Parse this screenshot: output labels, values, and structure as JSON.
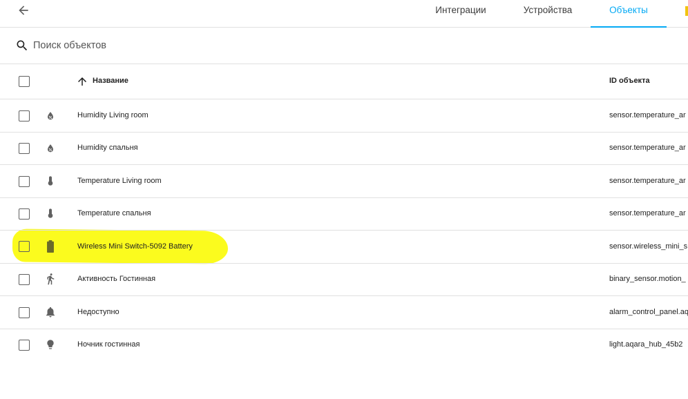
{
  "header": {
    "tabs": [
      {
        "label": "Интеграции",
        "active": false
      },
      {
        "label": "Устройства",
        "active": false
      },
      {
        "label": "Объекты",
        "active": true
      }
    ],
    "accent_color": "#03a9f4"
  },
  "search": {
    "placeholder": "Поиск объектов",
    "value": ""
  },
  "table": {
    "columns": {
      "name": "Название",
      "entity_id": "ID объекта"
    },
    "sort": {
      "column": "name",
      "direction": "ascending"
    },
    "rows": [
      {
        "icon": "water-percent-icon",
        "name": "Humidity Living room",
        "entity_id": "sensor.temperature_ar",
        "highlighted": false
      },
      {
        "icon": "water-percent-icon",
        "name": "Humidity спальня",
        "entity_id": "sensor.temperature_ar",
        "highlighted": false
      },
      {
        "icon": "thermometer-icon",
        "name": "Temperature Living room",
        "entity_id": "sensor.temperature_ar",
        "highlighted": false
      },
      {
        "icon": "thermometer-icon",
        "name": "Temperature спальня",
        "entity_id": "sensor.temperature_ar",
        "highlighted": false
      },
      {
        "icon": "battery-icon",
        "name": "Wireless Mini Switch-5092 Battery",
        "entity_id": "sensor.wireless_mini_s",
        "highlighted": true
      },
      {
        "icon": "run-icon",
        "name": "Активность Гостинная",
        "entity_id": "binary_sensor.motion_",
        "highlighted": false
      },
      {
        "icon": "bell-icon",
        "name": "Недоступно",
        "entity_id": "alarm_control_panel.aq",
        "highlighted": false
      },
      {
        "icon": "lightbulb-icon",
        "name": "Ночник гостинная",
        "entity_id": "light.aqara_hub_45b2",
        "highlighted": false
      }
    ]
  },
  "highlight_color": "#fbfb1e"
}
